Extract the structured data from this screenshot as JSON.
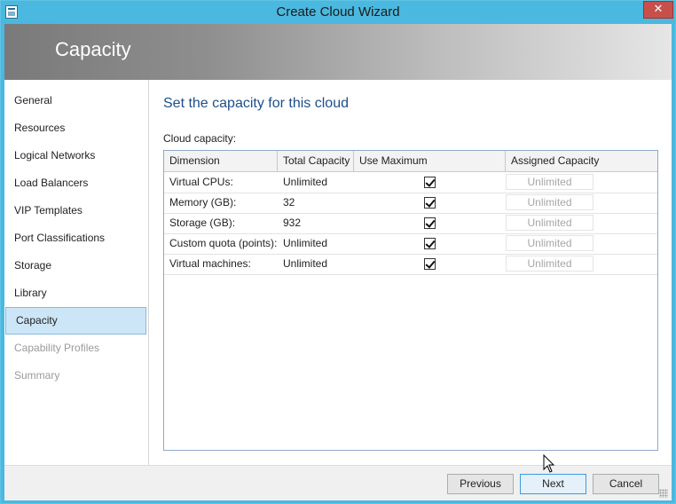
{
  "window": {
    "title": "Create Cloud Wizard",
    "close_label": "✕"
  },
  "banner": {
    "title": "Capacity"
  },
  "nav": {
    "items": [
      {
        "label": "General",
        "state": "normal"
      },
      {
        "label": "Resources",
        "state": "normal"
      },
      {
        "label": "Logical Networks",
        "state": "normal"
      },
      {
        "label": "Load Balancers",
        "state": "normal"
      },
      {
        "label": "VIP Templates",
        "state": "normal"
      },
      {
        "label": "Port Classifications",
        "state": "normal"
      },
      {
        "label": "Storage",
        "state": "normal"
      },
      {
        "label": "Library",
        "state": "normal"
      },
      {
        "label": "Capacity",
        "state": "selected"
      },
      {
        "label": "Capability Profiles",
        "state": "disabled"
      },
      {
        "label": "Summary",
        "state": "disabled"
      }
    ]
  },
  "content": {
    "heading": "Set the capacity for this cloud",
    "grid_label": "Cloud capacity:",
    "columns": [
      "Dimension",
      "Total Capacity",
      "Use Maximum",
      "Assigned Capacity"
    ],
    "rows": [
      {
        "dimension": "Virtual CPUs:",
        "total": "Unlimited",
        "use_max": true,
        "assigned": "Unlimited"
      },
      {
        "dimension": "Memory (GB):",
        "total": "32",
        "use_max": true,
        "assigned": "Unlimited"
      },
      {
        "dimension": "Storage (GB):",
        "total": "932",
        "use_max": true,
        "assigned": "Unlimited"
      },
      {
        "dimension": "Custom quota (points):",
        "total": "Unlimited",
        "use_max": true,
        "assigned": "Unlimited"
      },
      {
        "dimension": "Virtual machines:",
        "total": "Unlimited",
        "use_max": true,
        "assigned": "Unlimited"
      }
    ]
  },
  "footer": {
    "previous_label": "Previous",
    "next_label": "Next",
    "cancel_label": "Cancel"
  },
  "colors": {
    "titlebar": "#4ab8df",
    "heading": "#1e4f8a",
    "selected_bg": "#cde6f7",
    "close": "#c7504a"
  }
}
